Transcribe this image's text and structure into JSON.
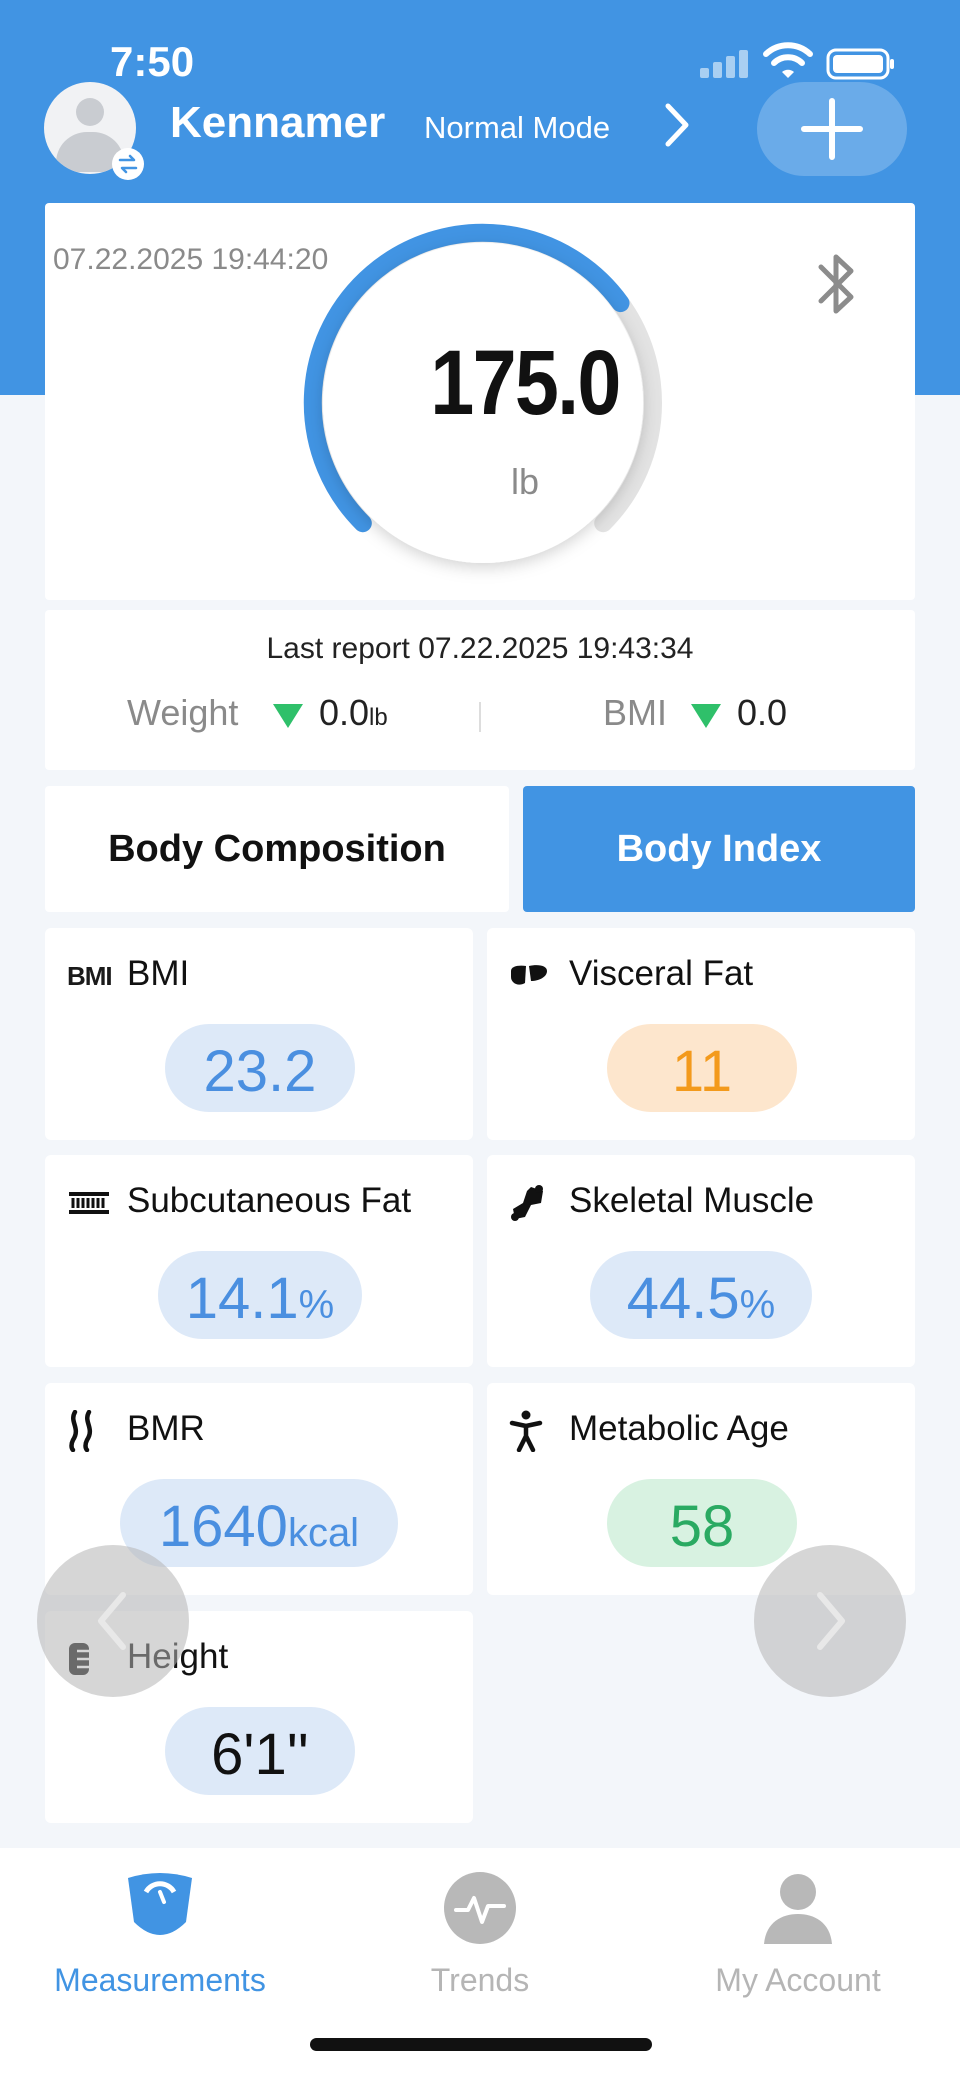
{
  "status": {
    "time": "7:50"
  },
  "header": {
    "user_name": "Kennamer",
    "mode": "Normal Mode"
  },
  "weight": {
    "timestamp": "07.22.2025 19:44:20",
    "value": "175.0",
    "unit": "lb",
    "gauge_fraction": 0.7
  },
  "report": {
    "title": "Last report 07.22.2025 19:43:34",
    "weight_label": "Weight",
    "weight_change": "0.0",
    "weight_unit": "lb",
    "bmi_label": "BMI",
    "bmi_change": "0.0"
  },
  "tabs": {
    "composition": "Body Composition",
    "index": "Body Index"
  },
  "metrics": {
    "bmi": {
      "icon_text": "BMI",
      "label": "BMI",
      "value": "23.2",
      "unit": ""
    },
    "visceral_fat": {
      "label": "Visceral Fat",
      "value": "11",
      "unit": ""
    },
    "subcutaneous_fat": {
      "label": "Subcutaneous Fat",
      "value": "14.1",
      "unit": "%"
    },
    "skeletal_muscle": {
      "label": "Skeletal Muscle",
      "value": "44.5",
      "unit": "%"
    },
    "bmr": {
      "label": "BMR",
      "value": "1640",
      "unit": "kcal"
    },
    "metabolic_age": {
      "label": "Metabolic Age",
      "value": "58",
      "unit": ""
    },
    "height": {
      "label": "Height",
      "value": "6'1''",
      "unit": ""
    }
  },
  "bottom_nav": {
    "measurements": "Measurements",
    "trends": "Trends",
    "account": "My Account"
  },
  "colors": {
    "primary": "#4194e3",
    "orange": "#f39a1c",
    "green": "#2aaa62",
    "down_arrow": "#2fc06a"
  }
}
